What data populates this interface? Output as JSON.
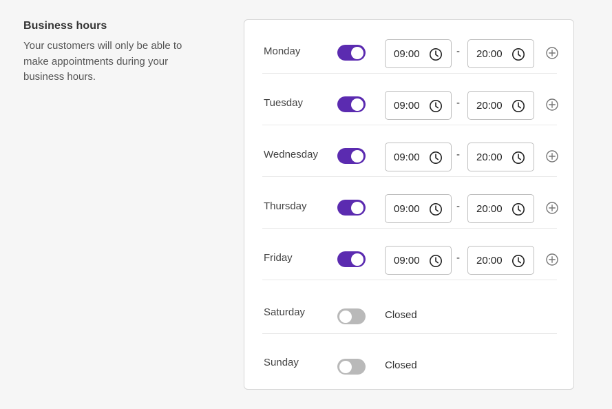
{
  "section": {
    "title": "Business hours",
    "description": "Your customers will only be able to make appointments during your business hours."
  },
  "separator": "-",
  "closed_label": "Closed",
  "colors": {
    "toggle_on": "#5b2bb0",
    "toggle_off": "#b9b9b9"
  },
  "icons": {
    "time": "clock-icon",
    "add": "plus-circle-icon"
  },
  "days": [
    {
      "name": "Monday",
      "open": true,
      "start": "09:00",
      "end": "20:00"
    },
    {
      "name": "Tuesday",
      "open": true,
      "start": "09:00",
      "end": "20:00"
    },
    {
      "name": "Wednesday",
      "open": true,
      "start": "09:00",
      "end": "20:00"
    },
    {
      "name": "Thursday",
      "open": true,
      "start": "09:00",
      "end": "20:00"
    },
    {
      "name": "Friday",
      "open": true,
      "start": "09:00",
      "end": "20:00"
    },
    {
      "name": "Saturday",
      "open": false
    },
    {
      "name": "Sunday",
      "open": false
    }
  ]
}
